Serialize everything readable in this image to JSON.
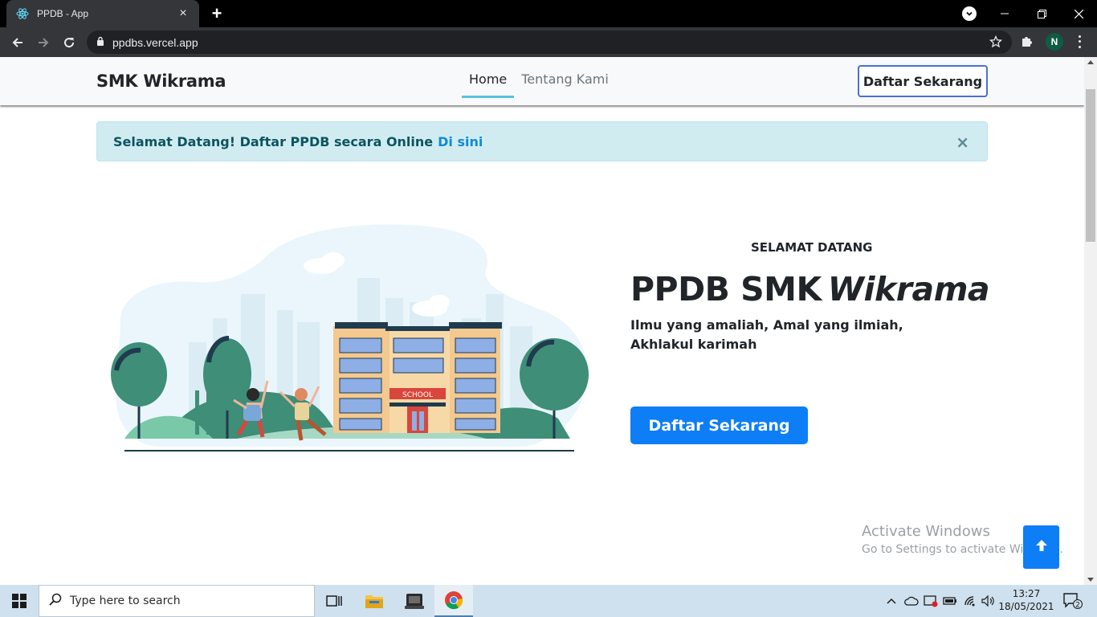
{
  "browser": {
    "tab_title": "PPDB - App",
    "url": "ppdbs.vercel.app",
    "profile_initial": "N"
  },
  "navbar": {
    "brand": "SMK Wikrama",
    "links": [
      {
        "label": "Home",
        "active": true
      },
      {
        "label": "Tentang Kami",
        "active": false
      }
    ],
    "cta_label": "Daftar Sekarang"
  },
  "alert": {
    "text": "Selamat Datang! Daftar PPDB secara Online",
    "link_text": "Di sini",
    "close_symbol": "×"
  },
  "illustration": {
    "sign_text": "SCHOOL"
  },
  "hero": {
    "kicker": "SELAMAT DATANG",
    "title_plain": "PPDB SMK",
    "title_emphasis": "Wikrama",
    "tagline": "Ilmu yang amaliah, Amal yang ilmiah, Akhlakul karimah",
    "cta_label": "Daftar Sekarang"
  },
  "watermark": {
    "line1": "Activate Windows",
    "line2": "Go to Settings to activate Windows."
  },
  "taskbar": {
    "search_placeholder": "Type here to search",
    "time": "13:27",
    "date": "18/05/2021",
    "notification_count": "2"
  },
  "colors": {
    "primary": "#0d7ef5",
    "alert_bg": "#d1ecf1",
    "nav_active_underline": "#5bc0de",
    "illustration_green": "#3e8e78"
  }
}
